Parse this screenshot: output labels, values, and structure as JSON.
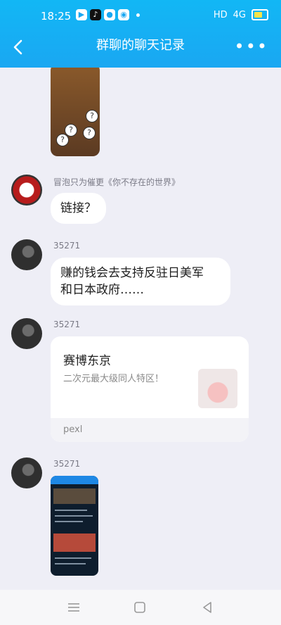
{
  "status_bar": {
    "time": "18:25",
    "app_icons": [
      "video-app-icon",
      "tiktok-icon",
      "wechat-icon",
      "camera-app-icon"
    ],
    "hd": "HD",
    "signal": "4G"
  },
  "header": {
    "title": "群聊的聊天记录",
    "back_icon": "chevron-left-icon",
    "more_icon": "more-icon",
    "more_label": "•••"
  },
  "messages": [
    {
      "type": "image",
      "sender": ""
    },
    {
      "type": "text",
      "sender": "冒泡只为催更《你不存在的世界》",
      "text": "链接？",
      "avatar": "red-star-avatar"
    },
    {
      "type": "text",
      "sender": "35271",
      "text": "赚的钱会去支持反驻日美军\n和日本政府……",
      "avatar": "dark-avatar"
    },
    {
      "type": "card",
      "sender": "35271",
      "title": "赛博东京",
      "desc": "二次元最大级同人特区！",
      "source": "pexl",
      "avatar": "dark-avatar"
    },
    {
      "type": "image",
      "sender": "35271",
      "avatar": "dark-avatar"
    }
  ],
  "nav": {
    "icons": [
      "menu-icon",
      "home-square-icon",
      "back-triangle-icon"
    ]
  },
  "colors": {
    "header": "#12b7f5",
    "background": "#eeeef6",
    "bubble": "#ffffff"
  }
}
